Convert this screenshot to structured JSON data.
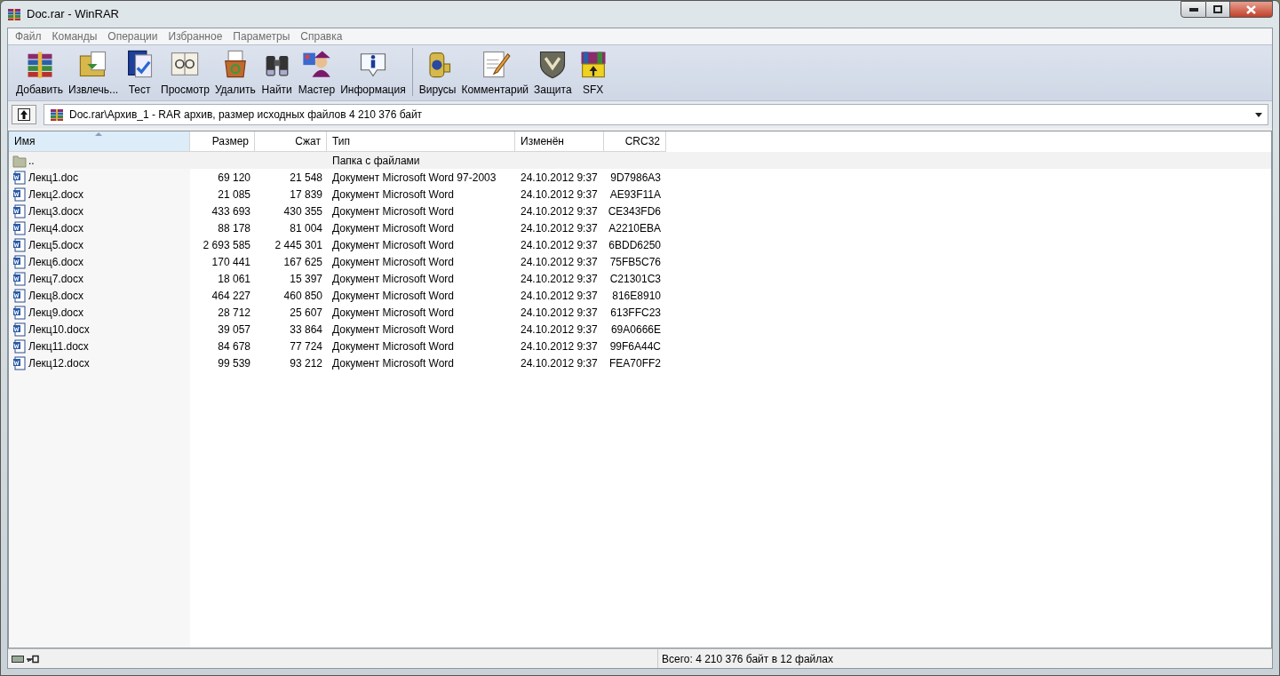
{
  "window": {
    "title": "Doc.rar - WinRAR"
  },
  "menu": [
    "Файл",
    "Команды",
    "Операции",
    "Избранное",
    "Параметры",
    "Справка"
  ],
  "toolbar": [
    {
      "label": "Добавить"
    },
    {
      "label": "Извлечь..."
    },
    {
      "label": "Тест"
    },
    {
      "label": "Просмотр"
    },
    {
      "label": "Удалить"
    },
    {
      "label": "Найти"
    },
    {
      "label": "Мастер"
    },
    {
      "label": "Информация"
    },
    {
      "label": "Вирусы",
      "group_start": true
    },
    {
      "label": "Комментарий"
    },
    {
      "label": "Защита"
    },
    {
      "label": "SFX"
    }
  ],
  "address": {
    "value": "Doc.rar\\Архив_1 - RAR архив, размер исходных файлов 4 210 376 байт"
  },
  "table": {
    "columns": [
      {
        "label": "Имя",
        "sorted": true
      },
      {
        "label": "Размер",
        "sorted": false
      },
      {
        "label": "Сжат",
        "sorted": false
      },
      {
        "label": "Тип",
        "sorted": false
      },
      {
        "label": "Изменён",
        "sorted": false
      },
      {
        "label": "CRC32",
        "sorted": false
      }
    ],
    "rows": [
      {
        "kind": "folder",
        "name": "..",
        "type": "Папка с файлами"
      },
      {
        "kind": "file",
        "name": "Лекц1.doc",
        "size": "69 120",
        "packed": "21 548",
        "type": "Документ Microsoft Word 97-2003",
        "modified": "24.10.2012 9:37",
        "crc": "9D7986A3"
      },
      {
        "kind": "file",
        "name": "Лекц2.docx",
        "size": "21 085",
        "packed": "17 839",
        "type": "Документ Microsoft Word",
        "modified": "24.10.2012 9:37",
        "crc": "AE93F11A"
      },
      {
        "kind": "file",
        "name": "Лекц3.docx",
        "size": "433 693",
        "packed": "430 355",
        "type": "Документ Microsoft Word",
        "modified": "24.10.2012 9:37",
        "crc": "CE343FD6"
      },
      {
        "kind": "file",
        "name": "Лекц4.docx",
        "size": "88 178",
        "packed": "81 004",
        "type": "Документ Microsoft Word",
        "modified": "24.10.2012 9:37",
        "crc": "A2210EBA"
      },
      {
        "kind": "file",
        "name": "Лекц5.docx",
        "size": "2 693 585",
        "packed": "2 445 301",
        "type": "Документ Microsoft Word",
        "modified": "24.10.2012 9:37",
        "crc": "6BDD6250"
      },
      {
        "kind": "file",
        "name": "Лекц6.docx",
        "size": "170 441",
        "packed": "167 625",
        "type": "Документ Microsoft Word",
        "modified": "24.10.2012 9:37",
        "crc": "75FB5C76"
      },
      {
        "kind": "file",
        "name": "Лекц7.docx",
        "size": "18 061",
        "packed": "15 397",
        "type": "Документ Microsoft Word",
        "modified": "24.10.2012 9:37",
        "crc": "C21301C3"
      },
      {
        "kind": "file",
        "name": "Лекц8.docx",
        "size": "464 227",
        "packed": "460 850",
        "type": "Документ Microsoft Word",
        "modified": "24.10.2012 9:37",
        "crc": "816E8910"
      },
      {
        "kind": "file",
        "name": "Лекц9.docx",
        "size": "28 712",
        "packed": "25 607",
        "type": "Документ Microsoft Word",
        "modified": "24.10.2012 9:37",
        "crc": "613FFC23"
      },
      {
        "kind": "file",
        "name": "Лекц10.docx",
        "size": "39 057",
        "packed": "33 864",
        "type": "Документ Microsoft Word",
        "modified": "24.10.2012 9:37",
        "crc": "69A0666E"
      },
      {
        "kind": "file",
        "name": "Лекц11.docx",
        "size": "84 678",
        "packed": "77 724",
        "type": "Документ Microsoft Word",
        "modified": "24.10.2012 9:37",
        "crc": "99F6A44C"
      },
      {
        "kind": "file",
        "name": "Лекц12.docx",
        "size": "99 539",
        "packed": "93 212",
        "type": "Документ Microsoft Word",
        "modified": "24.10.2012 9:37",
        "crc": "FEA70FF2"
      }
    ]
  },
  "status_bar": {
    "text": "Всего: 4 210 376 байт в 12 файлах"
  }
}
